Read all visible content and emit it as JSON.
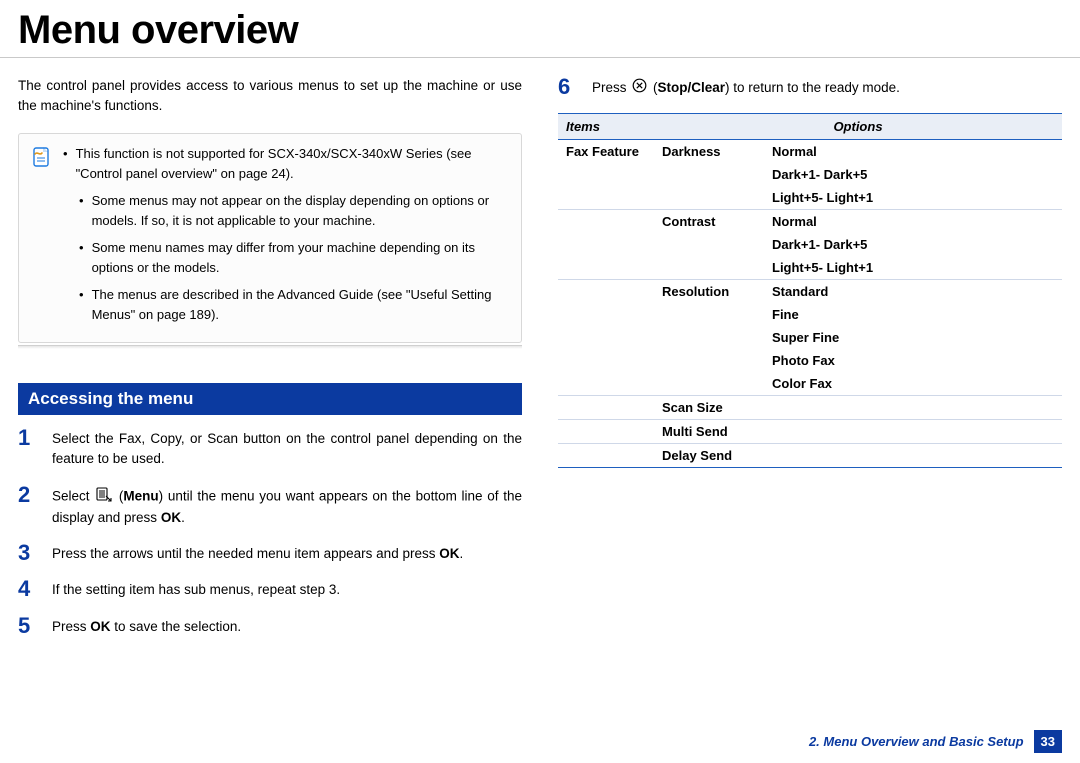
{
  "title": "Menu overview",
  "intro": "The control panel provides access to various menus to set up the machine or use the machine's functions.",
  "notes": {
    "items": [
      {
        "sub": false,
        "text": "This function is not supported for SCX-340x/SCX-340xW Series (see \"Control panel overview\" on page 24)."
      },
      {
        "sub": true,
        "text": "Some menus may not appear on the display depending on options or models. If so, it is not applicable to your machine."
      },
      {
        "sub": true,
        "text": "Some menu names may differ from your machine depending on its options or the models."
      },
      {
        "sub": true,
        "text": "The menus are described in the Advanced Guide (see \"Useful Setting Menus\" on page 189)."
      }
    ]
  },
  "section_heading": "Accessing the menu",
  "steps_left": [
    {
      "n": "1",
      "html": "Select the Fax, Copy, or Scan button on the control panel depending on the feature to be used."
    },
    {
      "n": "2",
      "html": "Select {menu_icon} (<b>Menu</b>) until the menu you want appears on the bottom line of the display and press <b>OK</b>."
    },
    {
      "n": "3",
      "html": "Press the arrows until the needed menu item appears and press <b>OK</b>."
    },
    {
      "n": "4",
      "html": "If the setting item has sub menus, repeat step 3."
    },
    {
      "n": "5",
      "html": "Press <b>OK</b> to save the selection."
    }
  ],
  "steps_right": [
    {
      "n": "6",
      "html": "Press {stop_icon} (<b>Stop/Clear</b>) to return to the ready mode."
    }
  ],
  "table": {
    "headers": {
      "items": "Items",
      "options": "Options"
    },
    "rows": [
      {
        "item": "Fax Feature",
        "sub": "Darkness",
        "opt": "Normal",
        "sep": false
      },
      {
        "item": "",
        "sub": "",
        "opt": "Dark+1- Dark+5",
        "sep": false
      },
      {
        "item": "",
        "sub": "",
        "opt": "Light+5- Light+1",
        "sep": false
      },
      {
        "item": "",
        "sub": "Contrast",
        "opt": "Normal",
        "sep": true
      },
      {
        "item": "",
        "sub": "",
        "opt": "Dark+1- Dark+5",
        "sep": false
      },
      {
        "item": "",
        "sub": "",
        "opt": "Light+5- Light+1",
        "sep": false
      },
      {
        "item": "",
        "sub": "Resolution",
        "opt": "Standard",
        "sep": true
      },
      {
        "item": "",
        "sub": "",
        "opt": "Fine",
        "sep": false
      },
      {
        "item": "",
        "sub": "",
        "opt": "Super Fine",
        "sep": false
      },
      {
        "item": "",
        "sub": "",
        "opt": "Photo Fax",
        "sep": false
      },
      {
        "item": "",
        "sub": "",
        "opt": "Color Fax",
        "sep": false
      },
      {
        "item": "",
        "sub": "Scan Size",
        "opt": "",
        "sep": true
      },
      {
        "item": "",
        "sub": "Multi Send",
        "opt": "",
        "sep": true
      },
      {
        "item": "",
        "sub": "Delay Send",
        "opt": "",
        "sep": true
      }
    ]
  },
  "footer": {
    "text": "2.  Menu Overview and Basic Setup",
    "page": "33"
  },
  "icons": {
    "menu_icon_name": "menu-icon",
    "stop_icon_name": "stop-clear-icon"
  }
}
